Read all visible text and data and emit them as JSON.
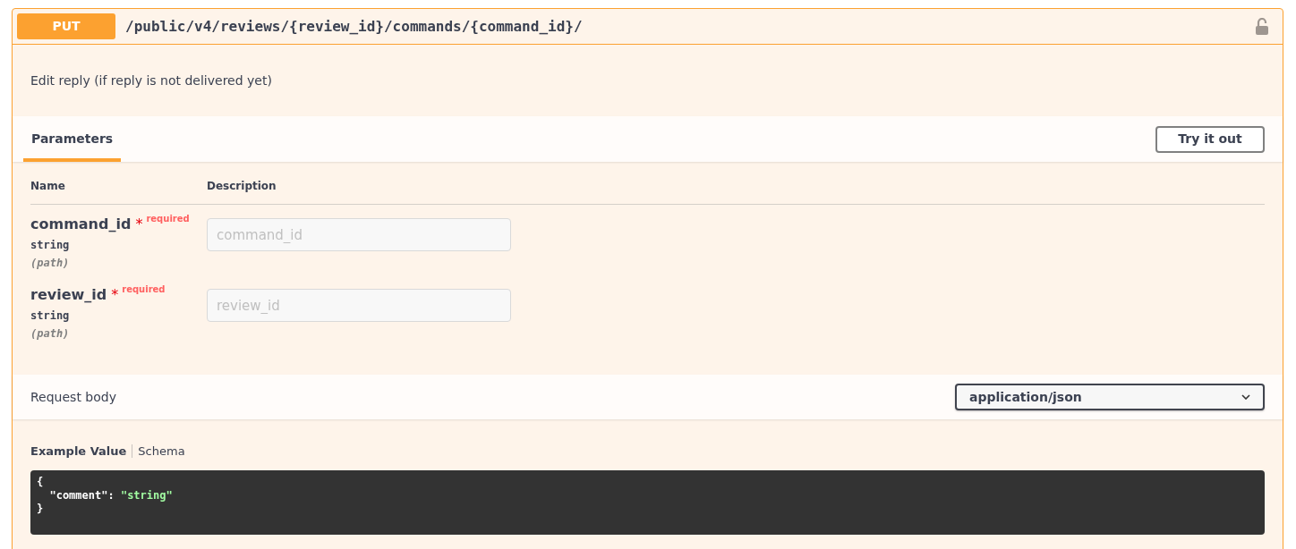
{
  "operation": {
    "method": "PUT",
    "path": "/public/v4/reviews/{review_id}/commands/{command_id}/",
    "locked": false
  },
  "description": "Edit reply (if reply is not delivered yet)",
  "parameters_tab": {
    "label": "Parameters",
    "selected": true
  },
  "try_button": "Try it out",
  "table": {
    "columns": [
      "Name",
      "Description"
    ],
    "rows": [
      {
        "name": "command_id",
        "required_mark": "*",
        "required_label": "required",
        "type": "string",
        "location": "(path)",
        "placeholder": "command_id"
      },
      {
        "name": "review_id",
        "required_mark": "*",
        "required_label": "required",
        "type": "string",
        "location": "(path)",
        "placeholder": "review_id"
      }
    ]
  },
  "request_body": {
    "label": "Request body",
    "content_type": "application/json"
  },
  "example_tabs": [
    {
      "label": "Example Value",
      "selected": true
    },
    {
      "label": "Schema",
      "selected": false
    }
  ],
  "code_lines": [
    [
      {
        "kind": "punct",
        "text": "{"
      }
    ],
    [
      {
        "kind": "indent"
      },
      {
        "kind": "key",
        "text": "\"comment\""
      },
      {
        "kind": "punct",
        "text": ": "
      },
      {
        "kind": "string",
        "text": "\"string\""
      }
    ],
    [
      {
        "kind": "punct",
        "text": "}"
      }
    ]
  ]
}
